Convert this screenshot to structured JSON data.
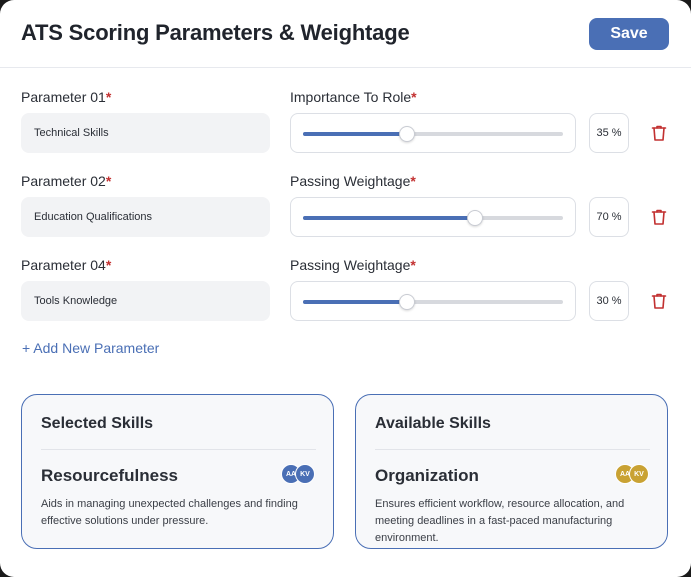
{
  "header": {
    "title": "ATS Scoring Parameters & Weightage",
    "save_label": "Save"
  },
  "parameters": [
    {
      "label": "Parameter 01",
      "required_mark": "*",
      "value": "Technical Skills",
      "slider_label": "Importance To Role",
      "slider_value": 0.4,
      "percent_text": "35 %",
      "delete_icon": "trash-icon"
    },
    {
      "label": "Parameter 02",
      "required_mark": "*",
      "value": "Education Qualifications",
      "slider_label": "Passing Weightage",
      "slider_value": 0.66,
      "percent_text": "70 %",
      "delete_icon": "trash-icon"
    },
    {
      "label": "Parameter 04",
      "required_mark": "*",
      "value": "Tools Knowledge",
      "slider_label": "Passing Weightage",
      "slider_value": 0.4,
      "percent_text": "30 %",
      "delete_icon": "trash-icon"
    }
  ],
  "add_parameter_label": "+ Add New Parameter",
  "selected_skills": {
    "title": "Selected Skills",
    "skill_name": "Resourcefulness",
    "description": "Aids in managing unexpected challenges and finding effective solutions under pressure.",
    "avatars": [
      "AA",
      "KV"
    ],
    "avatar_color": "#4a6fb5"
  },
  "available_skills": {
    "title": "Available Skills",
    "skill_name": "Organization",
    "description": "Ensures efficient workflow, resource allocation, and meeting deadlines in a fast-paced manufacturing environment.",
    "avatars": [
      "AA",
      "KV"
    ],
    "avatar_color": "#c9a233"
  },
  "colors": {
    "accent": "#4a6fb5",
    "required": "#c23030",
    "delete": "#c23030"
  }
}
